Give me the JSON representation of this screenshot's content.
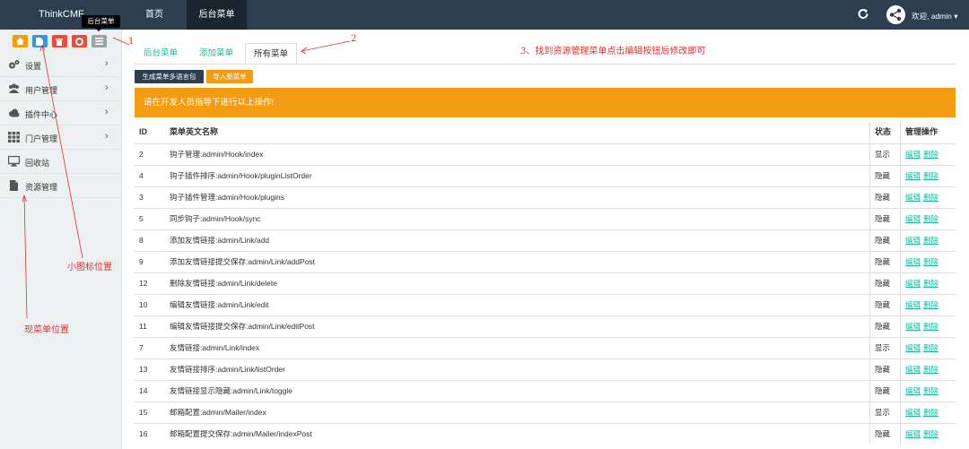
{
  "topbar": {
    "brand": "ThinkCMF",
    "nav": [
      "首页",
      "后台菜单"
    ],
    "welcome": "欢迎, admin ▾"
  },
  "sidebar": {
    "tooltip": "后台菜单",
    "shortcut_colors": [
      "#f39c12",
      "#3498db",
      "#e74c3c",
      "#e74c3c",
      "#95a5a6"
    ],
    "items": [
      {
        "label": "设置",
        "icon": "gears-icon",
        "chevron": "›"
      },
      {
        "label": "用户管理",
        "icon": "users-icon",
        "chevron": "›"
      },
      {
        "label": "插件中心",
        "icon": "cloud-icon",
        "chevron": "›"
      },
      {
        "label": "门户管理",
        "icon": "grid-icon",
        "chevron": "›"
      },
      {
        "label": "回收站",
        "icon": "desktop-icon",
        "chevron": ""
      },
      {
        "label": "资源管理",
        "icon": "file-icon",
        "chevron": ""
      }
    ]
  },
  "tabs": [
    "后台菜单",
    "添加菜单",
    "所有菜单"
  ],
  "buttons": {
    "generate": "生成菜单多语言包",
    "import": "导入新菜单"
  },
  "warning": "请在开发人员指导下进行以上操作!",
  "table": {
    "headers": [
      "ID",
      "菜单英文名称",
      "状态",
      "管理操作"
    ],
    "edit_label": "编辑",
    "delete_label": "删除",
    "rows": [
      {
        "id": "2",
        "name": "钩子管理:admin/Hook/index",
        "status": "显示"
      },
      {
        "id": "4",
        "name": "钩子插件排序:admin/Hook/pluginListOrder",
        "status": "隐藏"
      },
      {
        "id": "3",
        "name": "钩子插件管理:admin/Hook/plugins",
        "status": "隐藏"
      },
      {
        "id": "5",
        "name": "同步钩子:admin/Hook/sync",
        "status": "隐藏"
      },
      {
        "id": "8",
        "name": "添加友情链接:admin/Link/add",
        "status": "隐藏"
      },
      {
        "id": "9",
        "name": "添加友情链接提交保存:admin/Link/addPost",
        "status": "隐藏"
      },
      {
        "id": "12",
        "name": "删除友情链接:admin/Link/delete",
        "status": "隐藏"
      },
      {
        "id": "10",
        "name": "编辑友情链接:admin/Link/edit",
        "status": "隐藏"
      },
      {
        "id": "11",
        "name": "编辑友情链接提交保存:admin/Link/editPost",
        "status": "隐藏"
      },
      {
        "id": "7",
        "name": "友情链接:admin/Link/index",
        "status": "显示"
      },
      {
        "id": "13",
        "name": "友情链接排序:admin/Link/listOrder",
        "status": "隐藏"
      },
      {
        "id": "14",
        "name": "友情链接显示隐藏:admin/Link/toggle",
        "status": "隐藏"
      },
      {
        "id": "15",
        "name": "邮箱配置:admin/Mailer/index",
        "status": "显示"
      },
      {
        "id": "16",
        "name": "邮箱配置提交保存:admin/Mailer/indexPost",
        "status": "隐藏"
      }
    ]
  },
  "annotations": {
    "a1": "1",
    "a2": "2",
    "a3": "3、找到资源管理菜单点击编辑按钮后修改即可",
    "small_icon": "小图标位置",
    "current_menu": "现菜单位置"
  },
  "colors": {
    "navbar": "#2c3e50",
    "accent": "#18bc9c",
    "warning": "#f39c12",
    "annotation": "#e03030"
  }
}
